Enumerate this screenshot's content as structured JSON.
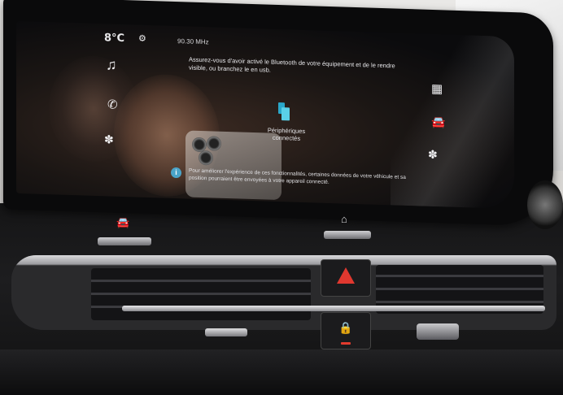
{
  "climate": {
    "temperature": "8°C"
  },
  "radio": {
    "frequency": "90.30 MHz"
  },
  "message": {
    "bluetooth_prompt": "Assurez-vous d'avoir activé le Bluetooth de votre équipement et de le rendre visible, ou branchez le en usb."
  },
  "devices": {
    "label": "Périphériques connectés"
  },
  "info": {
    "notice": "Pour améliorer l'expérience de ces fonctionnalités, certaines données de votre véhicule et sa position pourraient être envoyées à votre appareil connecté."
  },
  "icons": {
    "gear": "⚙",
    "music": "♫",
    "phone": "✆",
    "fan": "✽",
    "grid": "▦",
    "car": "🚘",
    "info": "i",
    "home": "⌂",
    "lock": "🔒"
  },
  "colors": {
    "hazard": "#e0382f",
    "accent": "#2aa7c9",
    "info_badge": "#4aa3c8"
  }
}
